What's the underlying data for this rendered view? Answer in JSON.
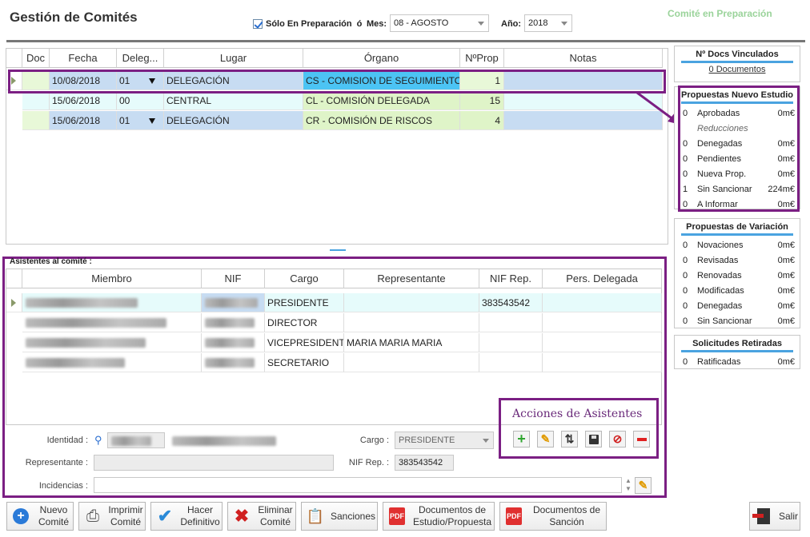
{
  "header": {
    "title": "Gestión de Comités",
    "status": "Comité en Preparación",
    "only_prep_label": "Sólo En Preparación",
    "or_label": "ó",
    "mes_label": "Mes:",
    "mes_value": "08 - AGOSTO",
    "anio_label": "Año:",
    "anio_value": "2018"
  },
  "comites": {
    "columns": [
      "Doc",
      "Fecha",
      "Deleg...",
      "Lugar",
      "Órgano",
      "NºProp",
      "Notas"
    ],
    "rows": [
      {
        "fecha": "10/08/2018",
        "deleg": "01",
        "lugar": "DELEGACIÓN",
        "organo": "CS - COMISION DE SEGUIMIENTO",
        "nprop": "1"
      },
      {
        "fecha": "15/06/2018",
        "deleg": "00",
        "lugar": "CENTRAL",
        "organo": "CL - COMISIÓN DELEGADA",
        "nprop": "15"
      },
      {
        "fecha": "15/06/2018",
        "deleg": "01",
        "lugar": "DELEGACIÓN",
        "organo": "CR - COMISIÓN DE RISCOS",
        "nprop": "4"
      }
    ]
  },
  "docs": {
    "title": "Nº Docs Vinculados",
    "link": "0 Documentos"
  },
  "nuevo_estudio": {
    "title": "Propuestas Nuevo Estudio",
    "rows": [
      {
        "n": "0",
        "label": "Aprobadas",
        "value": "0m€"
      },
      {
        "n": "",
        "label": "Reducciones",
        "value": ""
      },
      {
        "n": "0",
        "label": "Denegadas",
        "value": "0m€"
      },
      {
        "n": "0",
        "label": "Pendientes",
        "value": "0m€"
      },
      {
        "n": "0",
        "label": "Nueva Prop.",
        "value": "0m€"
      },
      {
        "n": "1",
        "label": "Sin Sancionar",
        "value": "224m€"
      },
      {
        "n": "0",
        "label": "A Informar",
        "value": "0m€"
      }
    ]
  },
  "variacion": {
    "title": "Propuestas de Variación",
    "rows": [
      {
        "n": "0",
        "label": "Novaciones",
        "value": "0m€"
      },
      {
        "n": "0",
        "label": "Revisadas",
        "value": "0m€"
      },
      {
        "n": "0",
        "label": "Renovadas",
        "value": "0m€"
      },
      {
        "n": "0",
        "label": "Modificadas",
        "value": "0m€"
      },
      {
        "n": "0",
        "label": "Denegadas",
        "value": "0m€"
      },
      {
        "n": "0",
        "label": "Sin Sancionar",
        "value": "0m€"
      }
    ]
  },
  "retiradas": {
    "title": "Solicitudes Retiradas",
    "rows": [
      {
        "n": "0",
        "label": "Ratificadas",
        "value": "0m€"
      }
    ]
  },
  "asistentes": {
    "label": "Asistentes al comité :",
    "columns": [
      "Miembro",
      "NIF",
      "Cargo",
      "Representante",
      "NIF Rep.",
      "Pers. Delegada"
    ],
    "rows": [
      {
        "cargo": "PRESIDENTE",
        "rep": "",
        "nifrep": "383543542"
      },
      {
        "cargo": "DIRECTOR",
        "rep": "",
        "nifrep": ""
      },
      {
        "cargo": "VICEPRESIDENTE",
        "rep": "MARIA MARIA MARIA",
        "nifrep": ""
      },
      {
        "cargo": "SECRETARIO",
        "rep": "",
        "nifrep": ""
      }
    ]
  },
  "form": {
    "identidad_label": "Identidad :",
    "cargo_label": "Cargo :",
    "cargo_value": "PRESIDENTE",
    "representante_label": "Representante :",
    "nifrep_label": "NIF Rep. :",
    "nifrep_value": "383543542",
    "incidencias_label": "Incidencias :"
  },
  "acciones_title": "Acciones de Asistentes",
  "buttons": {
    "nuevo": [
      "Nuevo",
      "Comité"
    ],
    "imprimir": [
      "Imprimir",
      "Comité"
    ],
    "definitivo": [
      "Hacer",
      "Definitivo"
    ],
    "eliminar": [
      "Eliminar",
      "Comité"
    ],
    "sanciones": "Sanciones",
    "doc_estudio": [
      "Documentos de",
      "Estudio/Propuesta"
    ],
    "doc_sancion": [
      "Documentos de",
      "Sanción"
    ],
    "salir": "Salir"
  }
}
